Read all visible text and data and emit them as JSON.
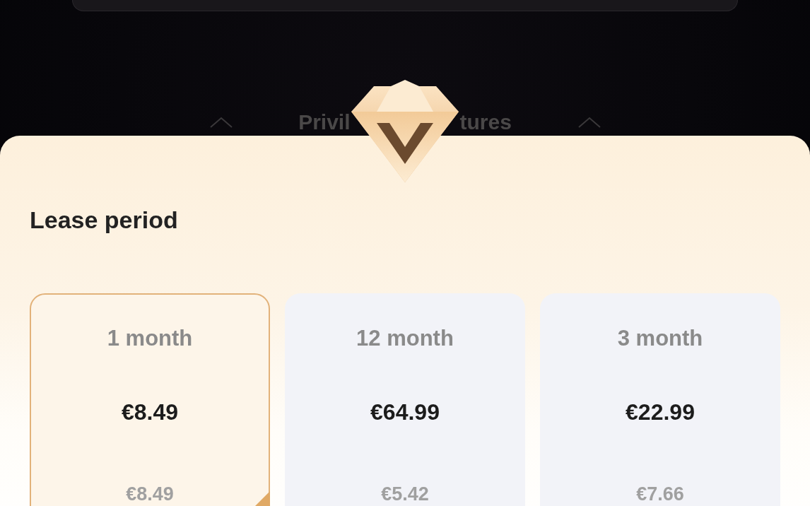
{
  "section_heading": {
    "left_part": "Privil",
    "right_part": "tures"
  },
  "lease": {
    "title": "Lease period",
    "plans": [
      {
        "period": "1 month",
        "price": "€8.49",
        "per_month": "€8.49",
        "selected": true
      },
      {
        "period": "12 month",
        "price": "€64.99",
        "per_month": "€5.42",
        "selected": false
      },
      {
        "period": "3 month",
        "price": "€22.99",
        "per_month": "€7.66",
        "selected": false
      }
    ]
  }
}
